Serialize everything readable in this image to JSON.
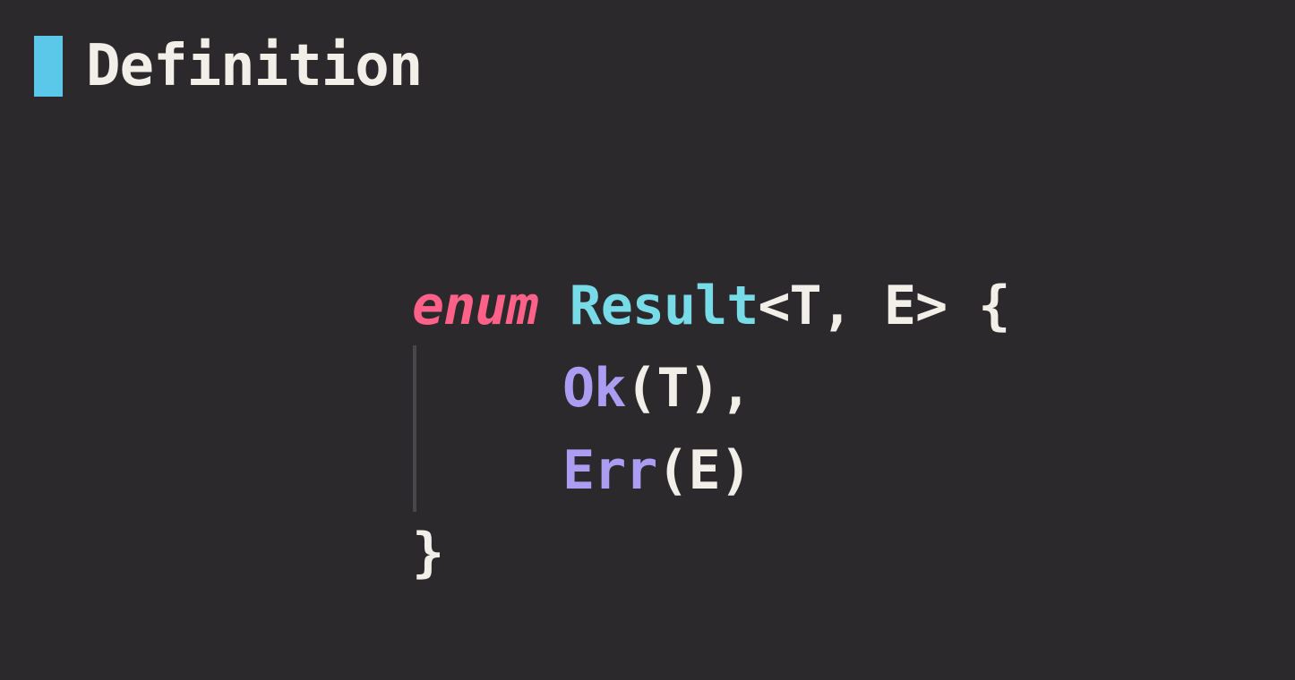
{
  "colors": {
    "background": "#2c292d",
    "accent": "#5bc8e9",
    "text": "#f2efe9",
    "keyword": "#ff6188",
    "type_name": "#78dce8",
    "variant": "#ab9df2",
    "indent_guide": "#4a474c"
  },
  "header": {
    "title": "Definition"
  },
  "code": {
    "line1": {
      "keyword": "enum",
      "space": " ",
      "type_name": "Result",
      "generics": "<T, E> {"
    },
    "line2": {
      "variant": "Ok",
      "rest": "(T),"
    },
    "line3": {
      "variant": "Err",
      "rest": "(E)"
    },
    "line4": {
      "text": "}"
    }
  }
}
